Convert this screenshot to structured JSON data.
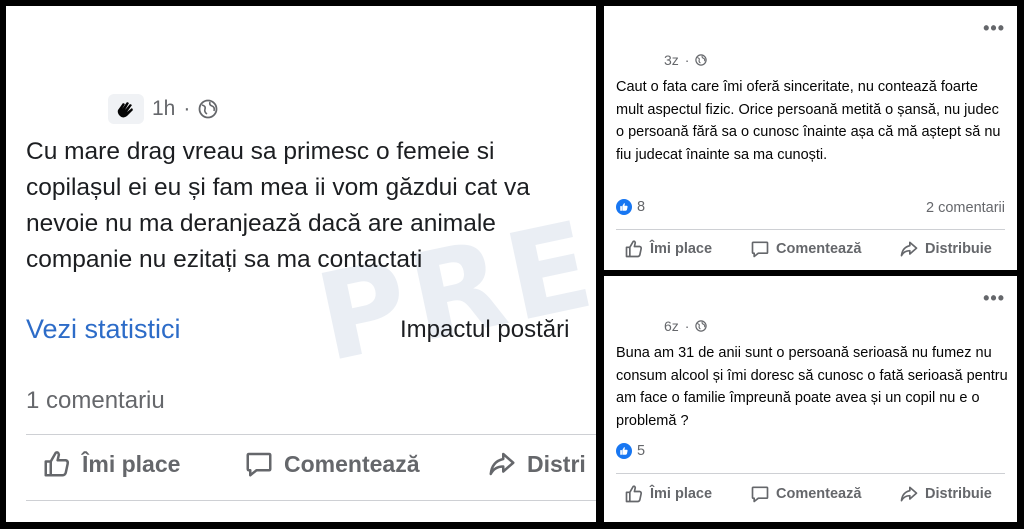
{
  "watermark": {
    "text": "PRESASM"
  },
  "left_post": {
    "time": "1h",
    "dot": "·",
    "text": "Cu mare drag vreau sa primesc o femeie si\ncopilașul ei eu și fam mea ii vom găzdui cat va\nnevoie nu ma deranjează dacă are animale\ncompanie  nu ezitați sa ma contactati",
    "stats_link": "Vezi statistici",
    "impact": "Impactul postări",
    "comments": "1 comentariu",
    "actions": {
      "like": "Îmi place",
      "comment": "Comentează",
      "share": "Distri"
    },
    "colors": {
      "link": "#2d6cc8",
      "muted": "#65676b"
    }
  },
  "right_top_post": {
    "time": "3z",
    "dot": "·",
    "menu": "•••",
    "text": "Caut o fata care îmi oferă sinceritate, nu contează foarte mult aspectul fizic. Orice persoană metită o șansă, nu judec o persoană fără sa o cunosc înainte așa că mă aștept să nu fiu judecat înainte sa ma cunoști.",
    "reactions": "8",
    "comments": "2 comentarii",
    "actions": {
      "like": "Îmi place",
      "comment": "Comentează",
      "share": "Distribuie"
    }
  },
  "right_bottom_post": {
    "time": "6z",
    "dot": "·",
    "menu": "•••",
    "text": "Buna am 31 de anii sunt o persoană serioasă nu fumez nu consum alcool și îmi doresc să cunosc o fată serioasă pentru am face o familie împreună poate avea și un copil nu e o problemă ?",
    "reactions": "5",
    "actions": {
      "like": "Îmi place",
      "comment": "Comentează",
      "share": "Distribuie"
    },
    "colors": {
      "like_badge": "#1877f2"
    }
  },
  "icons": [
    "hand-wave-icon",
    "globe-icon",
    "thumbs-up-icon",
    "comment-icon",
    "share-icon",
    "more-options-icon"
  ]
}
